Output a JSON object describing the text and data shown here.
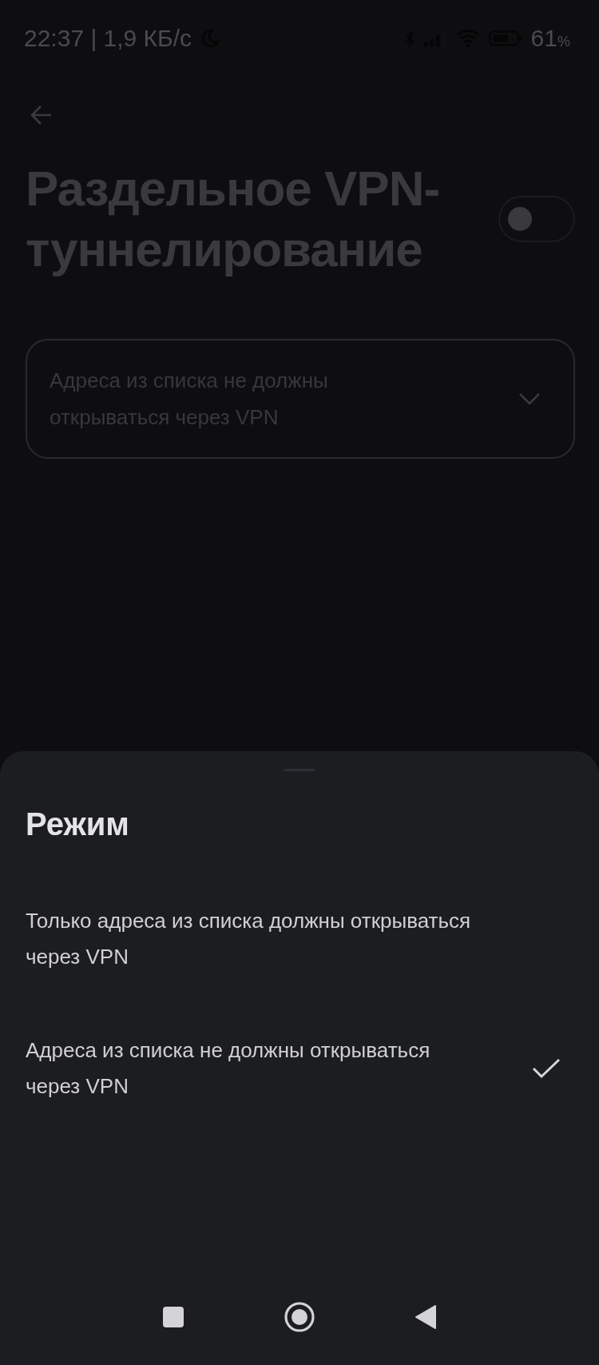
{
  "status_bar": {
    "time": "22:37 | 1,9 КБ/с",
    "battery": "61",
    "battery_unit": "%"
  },
  "header": {
    "title_lines": [
      "Раздельное VPN-",
      "туннелирование"
    ],
    "toggle": {
      "on": false
    }
  },
  "mode_dropdown": {
    "value_lines": [
      "Адреса из списка не должны",
      "открываться через VPN"
    ]
  },
  "sheet": {
    "title": "Режим",
    "options": [
      {
        "label_lines": [
          "Только адреса из списка должны открываться",
          "через VPN"
        ],
        "selected": false
      },
      {
        "label_lines": [
          "Адреса из списка не должны открываться",
          "через VPN"
        ],
        "selected": true
      }
    ]
  }
}
